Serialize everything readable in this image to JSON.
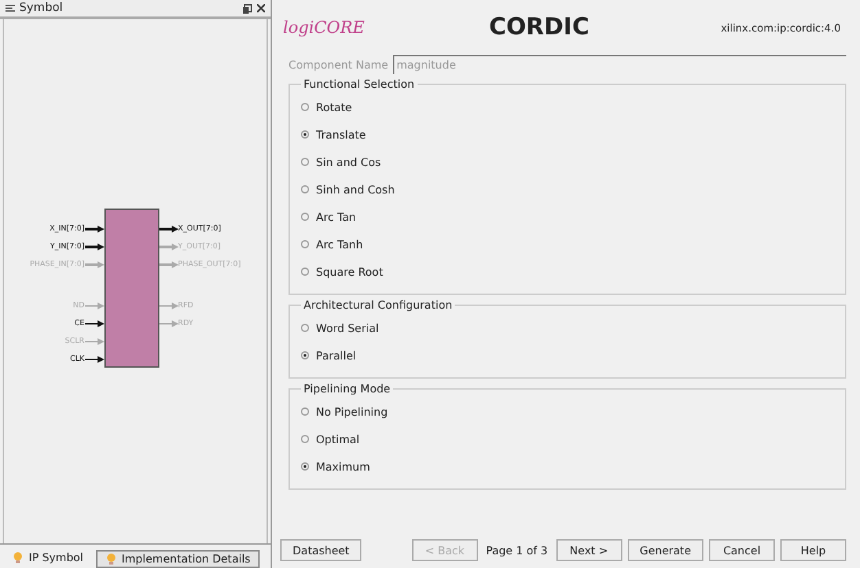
{
  "symbol_panel": {
    "title": "Symbol",
    "tabs": [
      {
        "label": "IP Symbol",
        "selected": true
      },
      {
        "label": "Implementation Details",
        "selected": false
      }
    ],
    "symbol": {
      "left_pins": [
        [
          {
            "label": "X_IN[7:0]",
            "active": true,
            "bus": true
          },
          {
            "label": "Y_IN[7:0]",
            "active": true,
            "bus": true
          },
          {
            "label": "PHASE_IN[7:0]",
            "active": false,
            "bus": true
          }
        ],
        [
          {
            "label": "ND",
            "active": false,
            "bus": false
          },
          {
            "label": "CE",
            "active": true,
            "bus": false
          },
          {
            "label": "SCLR",
            "active": false,
            "bus": false
          },
          {
            "label": "CLK",
            "active": true,
            "bus": false
          }
        ]
      ],
      "right_pins": [
        [
          {
            "label": "X_OUT[7:0]",
            "active": true,
            "bus": true
          },
          {
            "label": "Y_OUT[7:0]",
            "active": false,
            "bus": true
          },
          {
            "label": "PHASE_OUT[7:0]",
            "active": false,
            "bus": true
          }
        ],
        [
          {
            "label": "RFD",
            "active": false,
            "bus": false
          },
          {
            "label": "RDY",
            "active": false,
            "bus": false
          }
        ]
      ]
    }
  },
  "header": {
    "logo": "logiCORE",
    "title": "CORDIC",
    "vlnv": "xilinx.com:ip:cordic:4.0"
  },
  "component_name": {
    "label": "Component Name",
    "value": "magnitude"
  },
  "groups": [
    {
      "title": "Functional Selection",
      "options": [
        {
          "label": "Rotate",
          "selected": false
        },
        {
          "label": "Translate",
          "selected": true
        },
        {
          "label": "Sin and Cos",
          "selected": false
        },
        {
          "label": "Sinh and Cosh",
          "selected": false
        },
        {
          "label": "Arc Tan",
          "selected": false
        },
        {
          "label": "Arc Tanh",
          "selected": false
        },
        {
          "label": "Square Root",
          "selected": false
        }
      ]
    },
    {
      "title": "Architectural Configuration",
      "options": [
        {
          "label": "Word Serial",
          "selected": false
        },
        {
          "label": "Parallel",
          "selected": true
        }
      ]
    },
    {
      "title": "Pipelining Mode",
      "options": [
        {
          "label": "No Pipelining",
          "selected": false
        },
        {
          "label": "Optimal",
          "selected": false
        },
        {
          "label": "Maximum",
          "selected": true
        }
      ]
    }
  ],
  "footer": {
    "datasheet": "Datasheet",
    "back": {
      "label": "< Back",
      "disabled": true
    },
    "page": "Page 1 of 3",
    "next": {
      "label": "Next >",
      "disabled": false
    },
    "buttons": [
      "Generate",
      "Cancel",
      "Help"
    ]
  }
}
